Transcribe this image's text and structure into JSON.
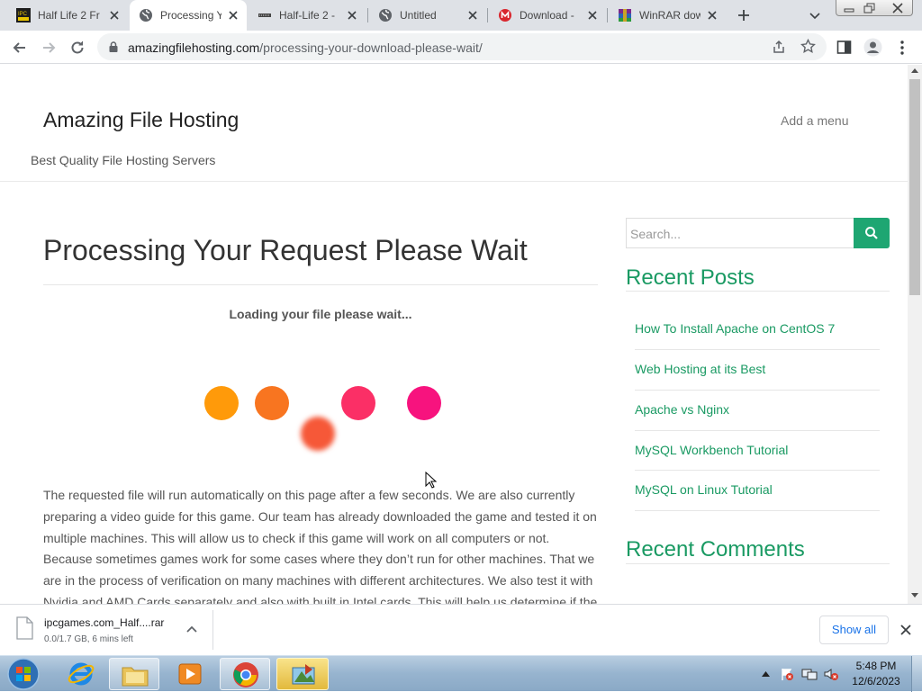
{
  "browser": {
    "tabs": [
      {
        "title": "Half Life 2 Fr",
        "favicon": "ipc-games-favicon"
      },
      {
        "title": "Processing Y",
        "favicon": "globe-icon",
        "active": true
      },
      {
        "title": "Half-Life 2 -",
        "favicon": "halflife-favicon"
      },
      {
        "title": "Untitled",
        "favicon": "globe-icon"
      },
      {
        "title": "Download -",
        "favicon": "mega-favicon"
      },
      {
        "title": "WinRAR dow",
        "favicon": "winrar-favicon"
      }
    ],
    "url_domain": "amazingfilehosting.com",
    "url_path": "/processing-your-download-please-wait/"
  },
  "site": {
    "title": "Amazing File Hosting",
    "tagline": "Best Quality File Hosting Servers",
    "menu_label": "Add a menu"
  },
  "main": {
    "heading": "Processing Your Request Please Wait",
    "loading_text": "Loading your file please wait...",
    "loader_colors": [
      "#ff9a0a",
      "#f87520",
      "#f65838",
      "#fb2f66",
      "#f7137e"
    ],
    "paragraph_lines": [
      "The requested file will run automatically on this page after a few seconds. We are also currently",
      "preparing a video guide for this game. Our team has already downloaded the game and tested it on",
      "multiple machines. This will allow us to check if this game will work on all computers or not.",
      "Because sometimes games work for some cases where they don’t run for other machines. That we",
      "are in the process of verification on many machines with different architectures. We also test it with",
      "Nvidia and AMD Cards separately and also with built in Intel cards. This will help us determine if the"
    ]
  },
  "sidebar": {
    "search_placeholder": "Search...",
    "recent_posts_title": "Recent Posts",
    "recent_posts": [
      "How To Install Apache on CentOS 7",
      "Web Hosting at its Best",
      "Apache vs Nginx",
      "MySQL Workbench Tutorial",
      "MySQL on Linux Tutorial"
    ],
    "recent_comments_title": "Recent Comments"
  },
  "download_bar": {
    "filename": "ipcgames.com_Half....rar",
    "status": "0.0/1.7 GB, 6 mins left",
    "show_all": "Show all"
  },
  "taskbar": {
    "time": "5:48 PM",
    "date": "12/6/2023"
  },
  "colors": {
    "accent": "#1a9a63",
    "search_button": "#1ea672",
    "chrome_tabstrip": "#dee1e6"
  }
}
